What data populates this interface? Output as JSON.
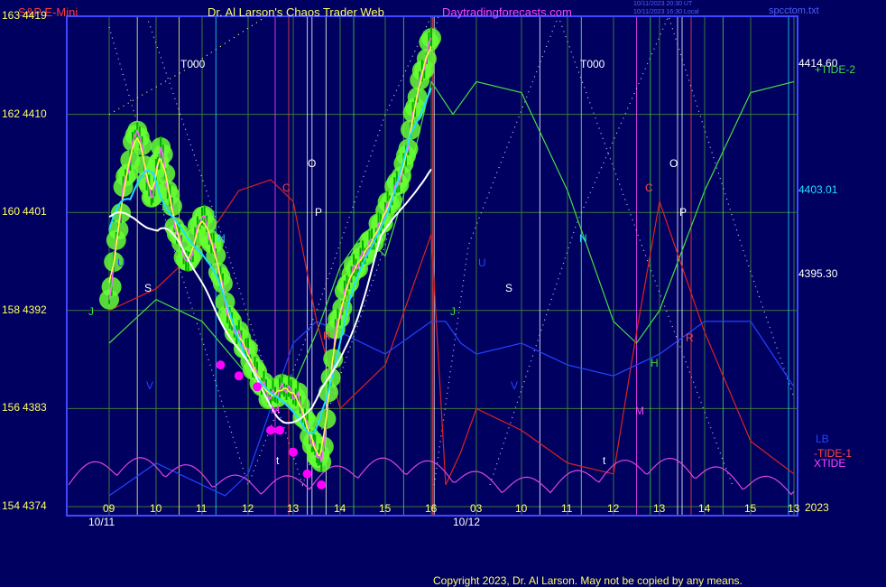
{
  "header": {
    "symbol": "S&P E-Mini",
    "title": "Dr. Al Larson's Chaos Trader Web",
    "site": "Daytradingforecasts.com",
    "stamp1": "10/11/2023 20:30 UT",
    "stamp2": "10/11/2023 16:30 Local",
    "file": "spcctom.txt"
  },
  "footer": {
    "copyright": "Copyright 2023, Dr. Al Larson. May not be copied by any means."
  },
  "colors": {
    "background": "#000060",
    "frame": "#3f48ff",
    "grid": "#3a7a3a",
    "candles": "#00ff00",
    "highlight": "#66ff33",
    "fast_ma": "#ffff44",
    "mid_ma": "#22ddff",
    "slow_ma": "#ffffff",
    "blue_line": "#2244ff",
    "red_line": "#dd2222",
    "tide2": "#44dd44",
    "xtide": "#dd44dd",
    "markers": "#ff00ff"
  },
  "chart_data": {
    "type": "line",
    "title": "S&P E-Mini",
    "y_axis_left": {
      "labels": [
        {
          "small": "163",
          "price": "4419",
          "value": 4419
        },
        {
          "small": "162",
          "price": "4410",
          "value": 4410
        },
        {
          "small": "160",
          "price": "4401",
          "value": 4401
        },
        {
          "small": "158",
          "price": "4392",
          "value": 4392
        },
        {
          "small": "156",
          "price": "4383",
          "value": 4383
        },
        {
          "small": "154",
          "price": "4374",
          "value": 4374
        }
      ],
      "ylim": [
        4374,
        4419
      ]
    },
    "right_price_labels": [
      {
        "text": "4414.60",
        "value": 4414.6
      },
      {
        "text": "4403.01",
        "value": 4403.01
      },
      {
        "text": "4395.30",
        "value": 4395.3
      }
    ],
    "right_series_labels": [
      "+TIDE-2",
      "LB",
      "-TIDE-1",
      "XTIDE",
      "2023"
    ],
    "x_axis": {
      "dates": [
        "10/11",
        "10/12"
      ],
      "hours": [
        "09",
        "10",
        "11",
        "12",
        "13",
        "14",
        "15",
        "16",
        "03",
        "10",
        "11",
        "12",
        "13",
        "14",
        "15",
        "13"
      ]
    },
    "annotations": [
      "T000",
      "T000",
      "O",
      "P",
      "C",
      "N",
      "J",
      "U",
      "S",
      "V",
      "t",
      "M",
      "R",
      "H",
      "O",
      "P",
      "C",
      "N",
      "J",
      "U",
      "S",
      "V",
      "t",
      "M",
      "R"
    ],
    "series": [
      {
        "name": "S&P E-Mini",
        "x_hours": [
          9.0,
          9.3,
          9.6,
          9.9,
          10.1,
          10.4,
          10.7,
          11.0,
          11.3,
          11.6,
          11.9,
          12.2,
          12.5,
          12.8,
          13.1,
          13.4,
          13.6,
          13.9,
          14.2,
          14.5,
          14.8,
          15.1,
          15.4,
          15.7,
          16.0
        ],
        "values": [
          4393,
          4403,
          4409,
          4402,
          4407,
          4400,
          4396,
          4401,
          4397,
          4391,
          4389,
          4386,
          4384,
          4385,
          4384,
          4380,
          4378,
          4390,
          4395,
          4397,
          4399,
          4402,
          4405,
          4412,
          4417
        ]
      },
      {
        "name": "+TIDE-2",
        "x_hours": [
          9.0,
          10.0,
          11.0,
          12.0,
          13.0,
          13.5,
          14.0,
          14.5,
          15.0,
          15.5,
          16.0,
          17.5,
          19.0,
          20.0,
          21.0,
          22.0,
          22.5,
          23.0,
          24.0,
          25.0,
          25.8
        ],
        "values": [
          4389,
          4393,
          4391,
          4386,
          4385,
          4390,
          4396,
          4399,
          4397,
          4404,
          4413,
          4410,
          4413,
          4412,
          4403,
          4391,
          4389,
          4392,
          4403,
          4412,
          4413
        ]
      },
      {
        "name": "-TIDE-1",
        "x_hours": [
          9.0,
          10.0,
          11.0,
          11.8,
          12.5,
          13.0,
          13.5,
          14.0,
          15.0,
          16.0,
          17.0,
          18.0,
          19.0,
          20.0,
          21.0,
          22.0,
          22.5,
          23.0,
          24.0,
          25.0,
          25.8
        ],
        "values": [
          4392,
          4394,
          4398,
          4403,
          4404,
          4402,
          4391,
          4383,
          4387,
          4399,
          4376,
          4379,
          4383,
          4381,
          4378,
          4377,
          4390,
          4402,
          4390,
          4380,
          4377
        ]
      },
      {
        "name": "LB",
        "x_hours": [
          9.0,
          10.0,
          11.0,
          11.5,
          12.0,
          12.5,
          13.0,
          13.5,
          14.0,
          15.0,
          16.0,
          17.0,
          18.0,
          19.0,
          20.0,
          21.0,
          22.0,
          23.0,
          24.0,
          25.0,
          25.8
        ],
        "values": [
          4375,
          4378,
          4376,
          4375,
          4377,
          4383,
          4389,
          4391,
          4390,
          4388,
          4391,
          4391,
          4389,
          4388,
          4389,
          4387,
          4386,
          4388,
          4391,
          4391,
          4385
        ]
      }
    ]
  }
}
